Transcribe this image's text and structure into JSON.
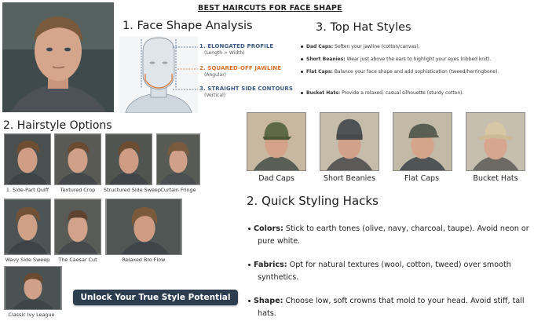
{
  "title": "BEST HAIRCUTS FOR FACE SHAPE",
  "face_analysis": {
    "heading": "1. Face Shape Analysis",
    "annotations": [
      {
        "label": "1. ELONGATED PROFILE",
        "sub": "(Length > Width)",
        "color": "#3b5b86"
      },
      {
        "label": "2. SQUARED-OFF JAWLINE",
        "sub": "(Angular)",
        "color": "#d9702a"
      },
      {
        "label": "3. STRAIGHT SIDE CONTOURS",
        "sub": "(Vertical)",
        "color": "#3b5b86"
      }
    ]
  },
  "hairstyles": {
    "heading": "2. Hairstyle Options",
    "items": [
      {
        "label": "1. Side-Part Quiff",
        "icon": "portrait-photo"
      },
      {
        "label": "Textured Crop",
        "icon": "portrait-photo"
      },
      {
        "label": "Structured Side Sweep",
        "icon": "portrait-photo"
      },
      {
        "label": "Curtain Fringe",
        "icon": "portrait-photo"
      },
      {
        "label": "Wavy Side Sweep",
        "icon": "portrait-photo"
      },
      {
        "label": "The Caesar Cut",
        "icon": "portrait-photo"
      },
      {
        "label": "Relaxed Bro Flow",
        "icon": "portrait-photo"
      },
      {
        "label": "Classic Ivy League",
        "icon": "portrait-photo"
      }
    ]
  },
  "hats": {
    "heading": "3. Top Hat Styles",
    "list": [
      {
        "name": "Dad Caps:",
        "text": "Soften your jawline (cotton/canvas)."
      },
      {
        "name": "Short Beanies:",
        "text": "Wear just above the ears to highlight your eyes (ribbed knit)."
      },
      {
        "name": "Flat Caps:",
        "text": "Balance your face shape and add sophistication (tweed/herringbone)."
      },
      {
        "name": "Bucket Hats:",
        "text": "Provide a relaxed, casual silhouette (sturdy cotton)."
      }
    ],
    "photos": [
      {
        "label": "Dad Caps",
        "hat_color": "#5f6a45"
      },
      {
        "label": "Short Beanies",
        "hat_color": "#4f5356"
      },
      {
        "label": "Flat Caps",
        "hat_color": "#5b5e52"
      },
      {
        "label": "Bucket Hats",
        "hat_color": "#d8c7a4"
      }
    ]
  },
  "hacks": {
    "heading": "2. Quick Styling Hacks",
    "items": [
      {
        "name": "Colors:",
        "text": "Stick to earth tones (olive, navy, charcoal, taupe). Avoid neon or pure white."
      },
      {
        "name": "Fabrics:",
        "text": "Opt for natural textures (wool, cotton, tweed) over smooth synthetics."
      },
      {
        "name": "Shape:",
        "text": "Choose low, soft crowns that mold to your head. Avoid stiff, tall hats."
      }
    ]
  },
  "cta": {
    "label": "Unlock Your True Style Potential",
    "color": "#2c3d4f"
  },
  "colors": {
    "accent_blue": "#3b5b86",
    "accent_orange": "#d9702a",
    "cta_bg": "#2c3d4f"
  }
}
